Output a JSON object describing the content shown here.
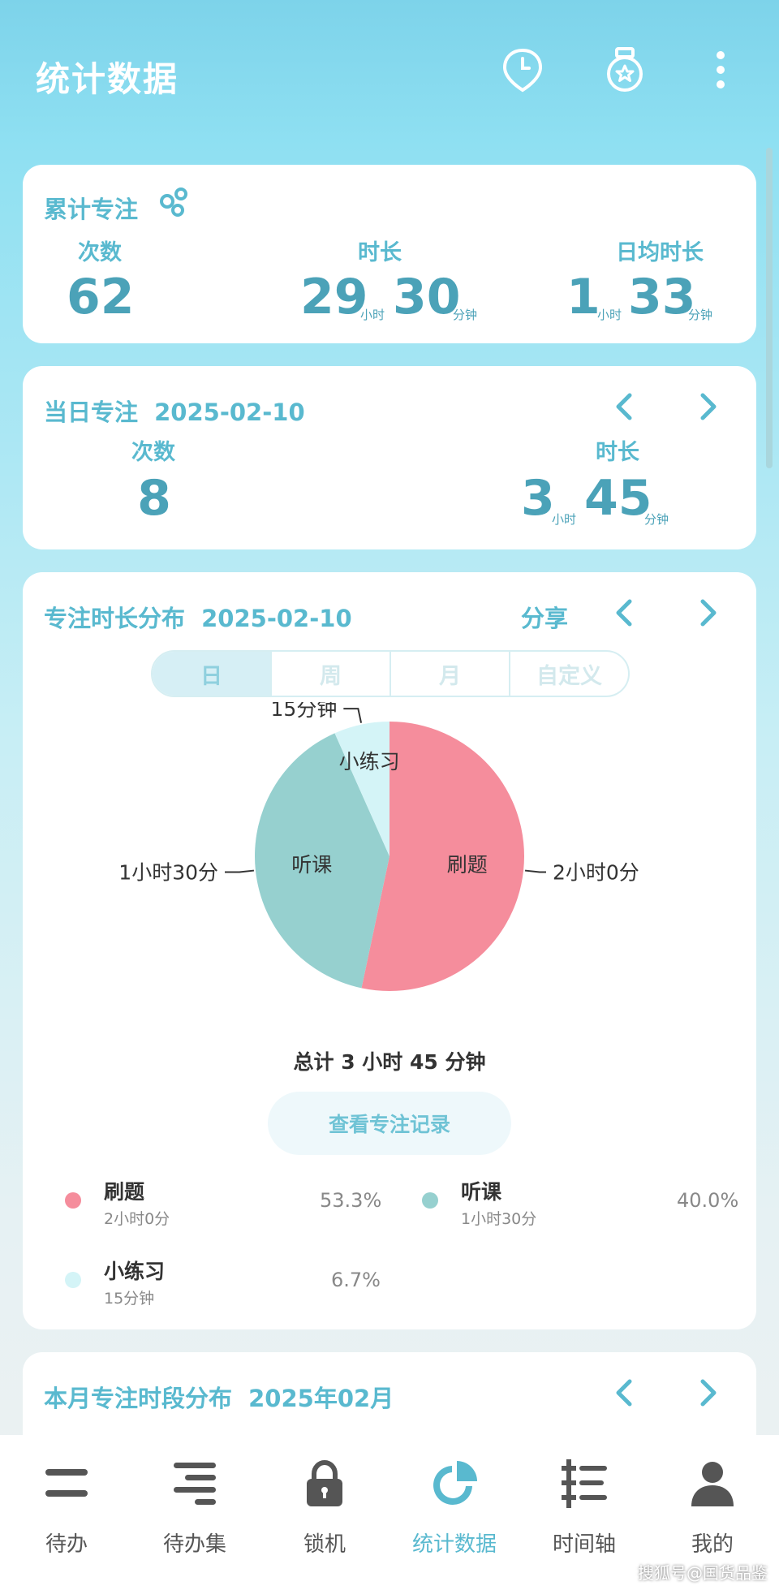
{
  "header": {
    "title": "统计数据"
  },
  "total_focus": {
    "title": "累计专注",
    "count_label": "次数",
    "count_value": "62",
    "duration_label": "时长",
    "duration_hours": "29",
    "duration_hours_unit": "小时",
    "duration_minutes": "30",
    "duration_minutes_unit": "分钟",
    "daily_avg_label": "日均时长",
    "daily_avg_hours": "1",
    "daily_avg_hours_unit": "小时",
    "daily_avg_minutes": "33",
    "daily_avg_minutes_unit": "分钟"
  },
  "day_focus": {
    "title": "当日专注",
    "date": "2025-02-10",
    "count_label": "次数",
    "count_value": "8",
    "duration_label": "时长",
    "duration_hours": "3",
    "duration_hours_unit": "小时",
    "duration_minutes": "45",
    "duration_minutes_unit": "分钟"
  },
  "distribution": {
    "title": "专注时长分布",
    "date": "2025-02-10",
    "share_label": "分享",
    "tabs": [
      "日",
      "周",
      "月",
      "自定义"
    ],
    "active_tab": 0,
    "total_text": "总计 3 小时 45 分钟",
    "records_button": "查看专注记录"
  },
  "chart_data": {
    "type": "pie",
    "slices": [
      {
        "name": "刷题",
        "value": 120,
        "label": "2小时0分",
        "percent": "53.3%",
        "legend_sub": "2小时0分",
        "color": "#f58d9c"
      },
      {
        "name": "听课",
        "value": 90,
        "label": "1小时30分",
        "percent": "40.0%",
        "legend_sub": "1小时30分",
        "color": "#96d0cf"
      },
      {
        "name": "小练习",
        "value": 15,
        "label": "15分钟",
        "percent": "6.7%",
        "legend_sub": "15分钟",
        "color": "#d4f4f7"
      }
    ]
  },
  "month_section": {
    "title": "本月专注时段分布",
    "date": "2025年02月"
  },
  "bottom_nav": [
    {
      "label": "待办",
      "icon": "todo-icon"
    },
    {
      "label": "待办集",
      "icon": "todo-set-icon"
    },
    {
      "label": "锁机",
      "icon": "lock-icon"
    },
    {
      "label": "统计数据",
      "icon": "stats-pie-icon"
    },
    {
      "label": "时间轴",
      "icon": "timeline-icon"
    },
    {
      "label": "我的",
      "icon": "profile-icon"
    }
  ],
  "active_nav": 3,
  "watermark": "搜狐号@国货品鉴",
  "colors": {
    "accent": "#59b9cf",
    "number": "#4ba2b8"
  }
}
